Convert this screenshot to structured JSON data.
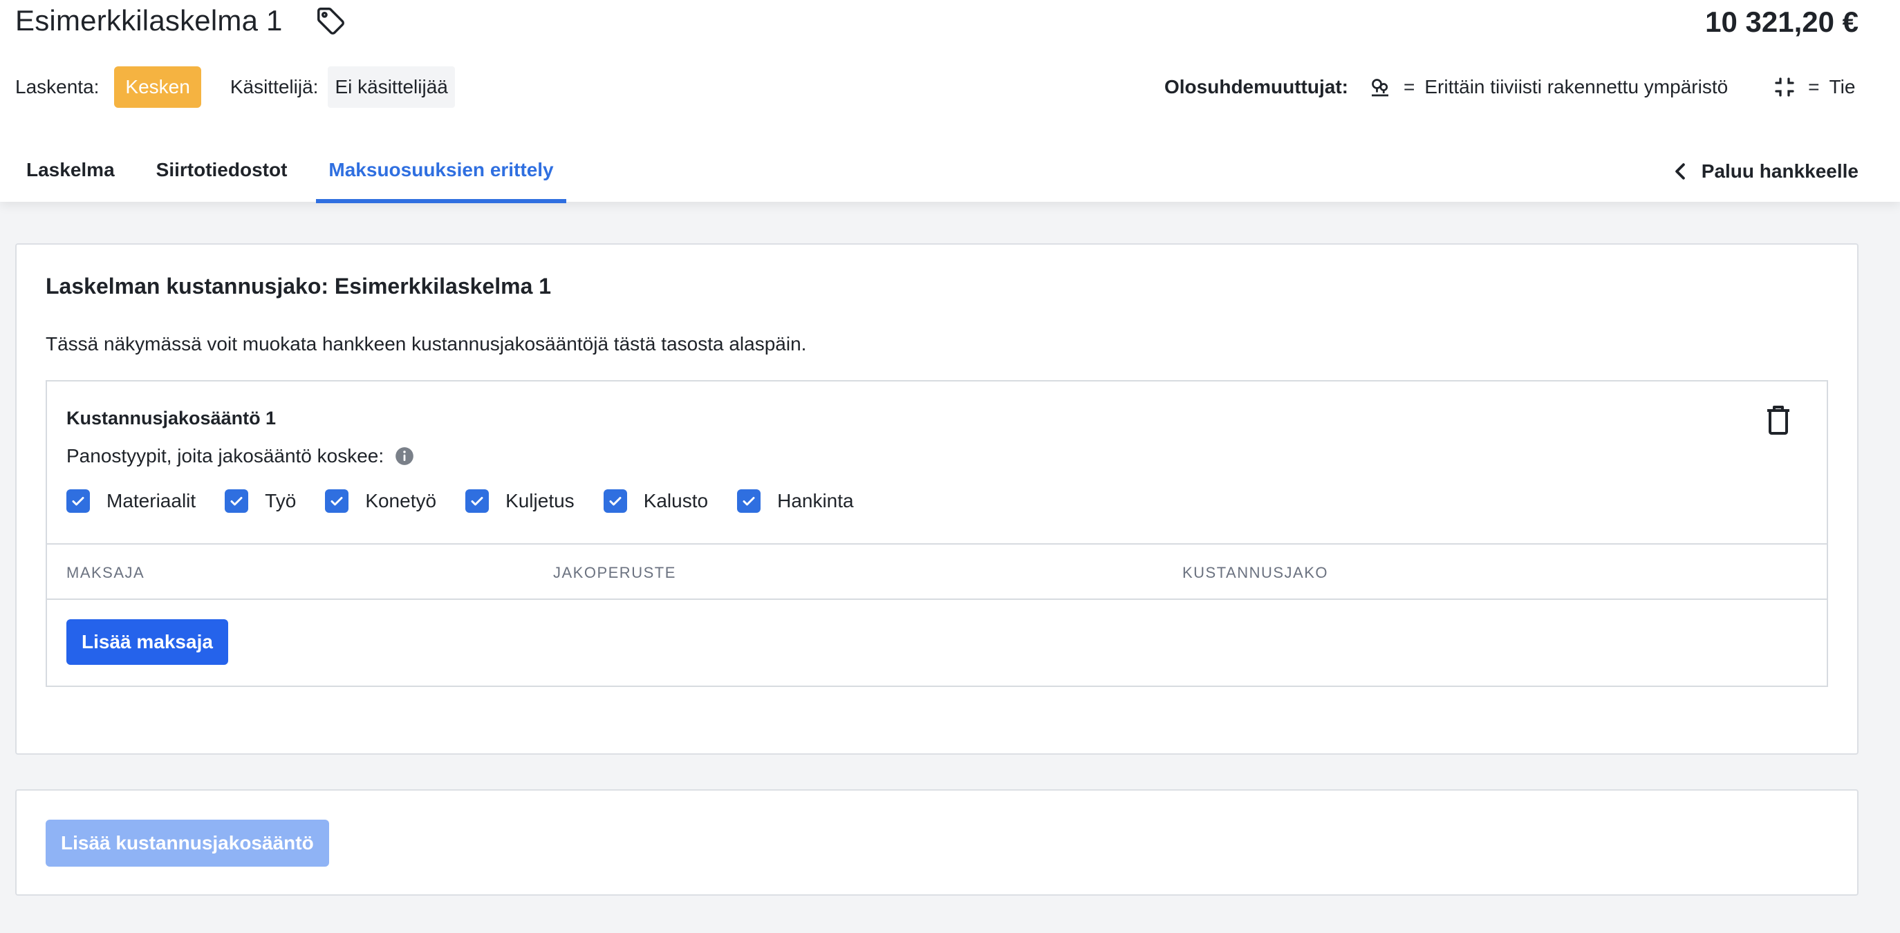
{
  "header": {
    "title": "Esimerkkilaskelma 1",
    "total": "10 321,20 €",
    "calc_label": "Laskenta:",
    "status": "Kesken",
    "handler_label": "Käsittelijä:",
    "handler_value": "Ei käsittelijää",
    "vars_label": "Olosuhdemuuttujat:",
    "var1_eq": "=",
    "var1_text": "Erittäin tiiviisti rakennettu ympäristö",
    "var2_eq": "=",
    "var2_text": "Tie"
  },
  "tabs": [
    {
      "label": "Laskelma",
      "active": false
    },
    {
      "label": "Siirtotiedostot",
      "active": false
    },
    {
      "label": "Maksuosuuksien erittely",
      "active": true
    }
  ],
  "back_label": "Paluu hankkeelle",
  "main": {
    "title": "Laskelman kustannusjako: Esimerkkilaskelma 1",
    "description": "Tässä näkymässä voit muokata hankkeen kustannusjakosääntöjä tästä tasosta alaspäin.",
    "rule": {
      "title": "Kustannusjakosääntö 1",
      "input_types_label": "Panostyypit, joita jakosääntö koskee:",
      "checkboxes": [
        {
          "label": "Materiaalit",
          "checked": true
        },
        {
          "label": "Työ",
          "checked": true
        },
        {
          "label": "Konetyö",
          "checked": true
        },
        {
          "label": "Kuljetus",
          "checked": true
        },
        {
          "label": "Kalusto",
          "checked": true
        },
        {
          "label": "Hankinta",
          "checked": true
        }
      ],
      "columns": {
        "payer": "MAKSAJA",
        "basis": "JAKOPERUSTE",
        "split": "KUSTANNUSJAKO"
      },
      "add_payer_label": "Lisää maksaja"
    }
  },
  "add_rule_label": "Lisää kustannusjakosääntö",
  "colors": {
    "accent": "#2f6fe0",
    "primary_button": "#2563eb",
    "disabled_button": "#8fb3f5",
    "status_badge": "#f5b341"
  }
}
